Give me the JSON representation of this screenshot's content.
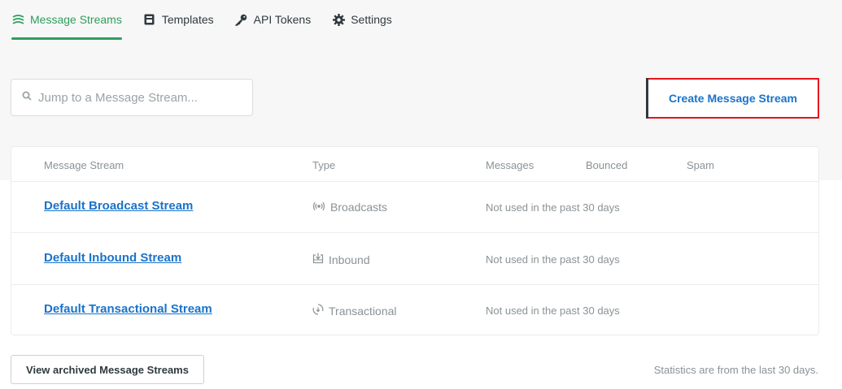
{
  "nav": {
    "tabs": [
      {
        "label": "Message Streams",
        "icon": "streams-icon",
        "active": true
      },
      {
        "label": "Templates",
        "icon": "template-icon",
        "active": false
      },
      {
        "label": "API Tokens",
        "icon": "key-icon",
        "active": false
      },
      {
        "label": "Settings",
        "icon": "gear-icon",
        "active": false
      }
    ]
  },
  "search": {
    "placeholder": "Jump to a Message Stream..."
  },
  "create_button": {
    "label": "Create Message Stream"
  },
  "table": {
    "headers": {
      "name": "Message Stream",
      "type": "Type",
      "messages": "Messages",
      "bounced": "Bounced",
      "spam": "Spam"
    },
    "rows": [
      {
        "name": "Default Broadcast Stream",
        "type": "Broadcasts",
        "type_icon": "broadcast-icon",
        "usage": "Not used in the past 30 days"
      },
      {
        "name": "Default Inbound Stream",
        "type": "Inbound",
        "type_icon": "inbound-icon",
        "usage": "Not used in the past 30 days"
      },
      {
        "name": "Default Transactional Stream",
        "type": "Transactional",
        "type_icon": "transactional-icon",
        "usage": "Not used in the past 30 days"
      }
    ]
  },
  "footer": {
    "archive_button": "View archived Message Streams",
    "stats_note": "Statistics are from the last 30 days."
  },
  "colors": {
    "accent_green": "#2f9e5e",
    "link_blue": "#1a73c9",
    "highlight_red": "#e8131c"
  }
}
